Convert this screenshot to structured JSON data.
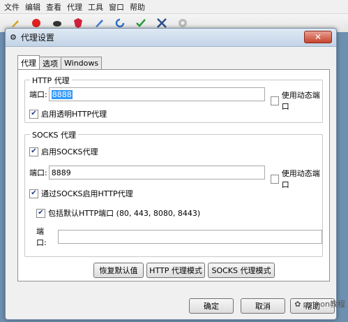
{
  "menu": [
    "文件",
    "编辑",
    "查看",
    "代理",
    "工具",
    "窗口",
    "帮助"
  ],
  "dialog": {
    "title": "代理设置",
    "close": "✕",
    "tabs": [
      "代理",
      "选项",
      "Windows"
    ],
    "http": {
      "title": "HTTP 代理",
      "port_label": "端口:",
      "port_value": "8888",
      "dynamic_label": "使用动态端口",
      "transparent_label": "启用透明HTTP代理"
    },
    "socks": {
      "title": "SOCKS 代理",
      "enable_label": "启用SOCKS代理",
      "port_label": "端口:",
      "port_value": "8889",
      "dynamic_label": "使用动态端口",
      "via_socks_label": "通过SOCKS启用HTTP代理",
      "include_default_label": "包括默认HTTP端口 (80, 443, 8080, 8443)",
      "port2_label": "端口:",
      "port2_value": ""
    },
    "buttons": {
      "restore": "恢复默认值",
      "http_mode": "HTTP 代理模式",
      "socks_mode": "SOCKS 代理模式",
      "ok": "确定",
      "cancel": "取消",
      "help": "帮助"
    }
  },
  "watermark": "python教程",
  "colors": {
    "selection": "#3399ff",
    "close": "#c7442e"
  }
}
